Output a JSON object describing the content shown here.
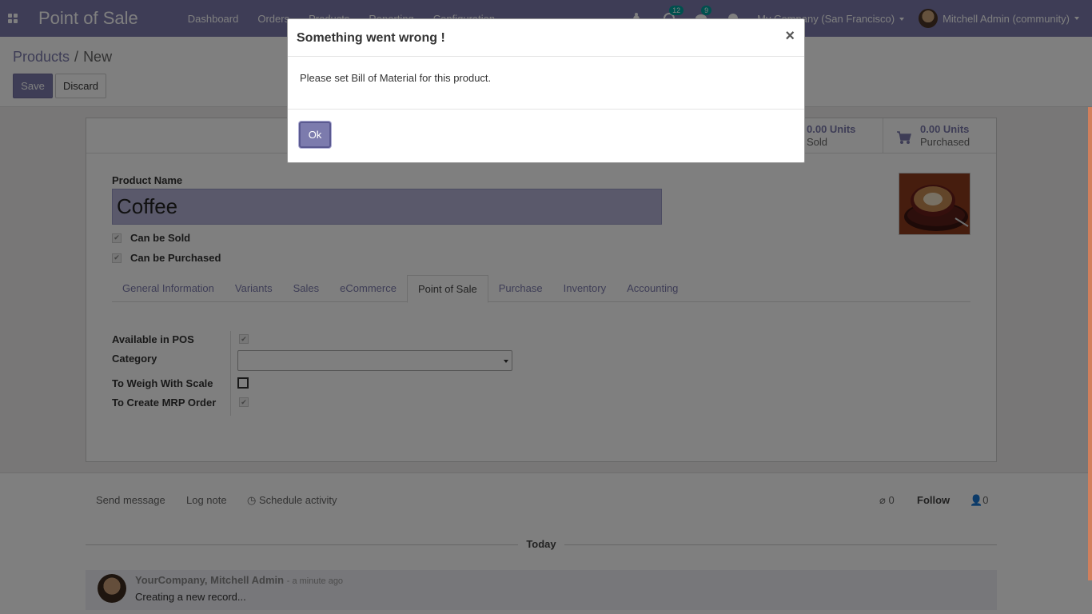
{
  "navbar": {
    "brand": "Point of Sale",
    "menu": [
      "Dashboard",
      "Orders",
      "Products",
      "Reporting",
      "Configuration"
    ],
    "activity_count": "12",
    "messages_count": "9",
    "company": "My Company (San Francisco)",
    "user": "Mitchell Admin (community)"
  },
  "breadcrumb": {
    "parent": "Products",
    "current": "New"
  },
  "actions": {
    "save": "Save",
    "discard": "Discard"
  },
  "stats": [
    {
      "value": "0.00 Units",
      "label": "Sold"
    },
    {
      "value": "0.00 Units",
      "label": "Purchased"
    }
  ],
  "form": {
    "name_label": "Product Name",
    "name_value": "Coffee",
    "can_be_sold": "Can be Sold",
    "can_be_purchased": "Can be Purchased",
    "tabs": [
      "General Information",
      "Variants",
      "Sales",
      "eCommerce",
      "Point of Sale",
      "Purchase",
      "Inventory",
      "Accounting"
    ],
    "active_tab": "Point of Sale",
    "pos": {
      "available_in_pos": "Available in POS",
      "category": "Category",
      "to_weigh": "To Weigh With Scale",
      "to_create_mrp": "To Create MRP Order"
    }
  },
  "chatter": {
    "send_message": "Send message",
    "log_note": "Log note",
    "schedule_activity": "Schedule activity",
    "attachments_count": "0",
    "follow": "Follow",
    "followers_count": "0",
    "today": "Today",
    "message": {
      "author": "YourCompany, Mitchell Admin",
      "time": "- a minute ago",
      "body": "Creating a new record..."
    }
  },
  "dialog": {
    "title": "Something went wrong !",
    "close": "×",
    "body": "Please set Bill of Material for this product.",
    "ok": "Ok"
  },
  "colors": {
    "primary": "#7c7bad",
    "badge": "#00a09d"
  },
  "icons": [
    "apps-icon",
    "bug-icon",
    "activity-icon",
    "chat-icon",
    "clock-icon",
    "cart-icon",
    "paperclip-icon",
    "user-icon",
    "close-icon"
  ]
}
